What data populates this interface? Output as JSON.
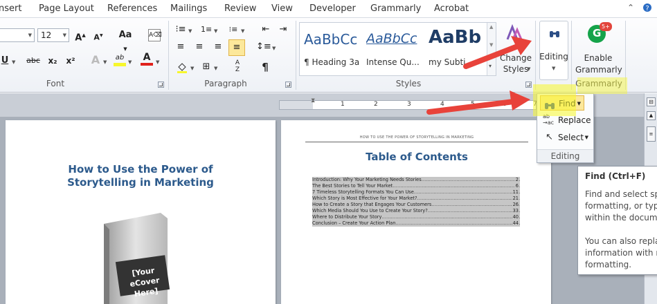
{
  "tabs": [
    "nsert",
    "Page Layout",
    "References",
    "Mailings",
    "Review",
    "View",
    "Developer",
    "Grammarly",
    "Acrobat"
  ],
  "font_group": {
    "size_value": "12",
    "grow_font": "A",
    "shrink_font": "A",
    "change_case": "Aa",
    "underline": "U",
    "strikethrough": "abc",
    "subscript": "x₂",
    "superscript": "x²",
    "text_effects": "A",
    "highlight": "ab",
    "font_color": "A",
    "label": "Font"
  },
  "paragraph_group": {
    "label": "Paragraph",
    "sort": "A↓Z",
    "pilcrow": "¶"
  },
  "styles_group": {
    "label": "Styles",
    "items": [
      {
        "preview": "AaBbCc",
        "name": "¶ Heading 3a"
      },
      {
        "preview": "AaBbCc",
        "name": "Intense Qu..."
      },
      {
        "preview": "AaBb",
        "name": "my Subti..."
      }
    ],
    "change_styles": "Change Styles"
  },
  "editing_button": {
    "label": "Editing"
  },
  "grammarly": {
    "label_line1": "Enable",
    "label_line2": "Grammarly",
    "badge": "5+",
    "group_label": "Grammarly"
  },
  "editing_menu": {
    "find": "Find",
    "replace": "Replace",
    "select": "Select",
    "group_label": "Editing"
  },
  "tooltip": {
    "title": "Find (Ctrl+F)",
    "lines": [
      "Find and select sp",
      "formatting, or typ",
      "within the docume",
      "",
      "You can also repla",
      "information with n",
      "formatting."
    ]
  },
  "ruler": {
    "marks": [
      "1",
      "2",
      "3",
      "4",
      "5",
      "6",
      "7"
    ]
  },
  "page1": {
    "title_line1": "How to Use the Power of",
    "title_line2": "Storytelling in Marketing",
    "ecover_line1": "[Your eCover",
    "ecover_line2": "Here]"
  },
  "page2": {
    "header": "HOW TO USE THE POWER OF STORYTELLING IN MARKETING",
    "toc_title": "Table of Contents",
    "toc": [
      {
        "text": "Introduction: Why Your Marketing Needs Stories",
        "page": "2"
      },
      {
        "text": "The Best Stories to Tell Your Market",
        "page": "6"
      },
      {
        "text": "7 Timeless Storytelling Formats You Can Use",
        "page": "11"
      },
      {
        "text": "Which Story is Most Effective for Your Market?",
        "page": "21"
      },
      {
        "text": "How to Create a Story that Engages Your Customers",
        "page": "26"
      },
      {
        "text": "Which Media Should You Use to Create Your Story?",
        "page": "33"
      },
      {
        "text": "Where to Distribute Your Story",
        "page": "40"
      },
      {
        "text": "Conclusion – Create Your Action Plan",
        "page": "44"
      }
    ]
  },
  "colors": {
    "title_blue": "#2c5a8c",
    "highlight_yellow": "#f7f72c",
    "arrow_red": "#e8423a",
    "grammarly_green": "#15a34a",
    "badge_red": "#e2453c"
  }
}
